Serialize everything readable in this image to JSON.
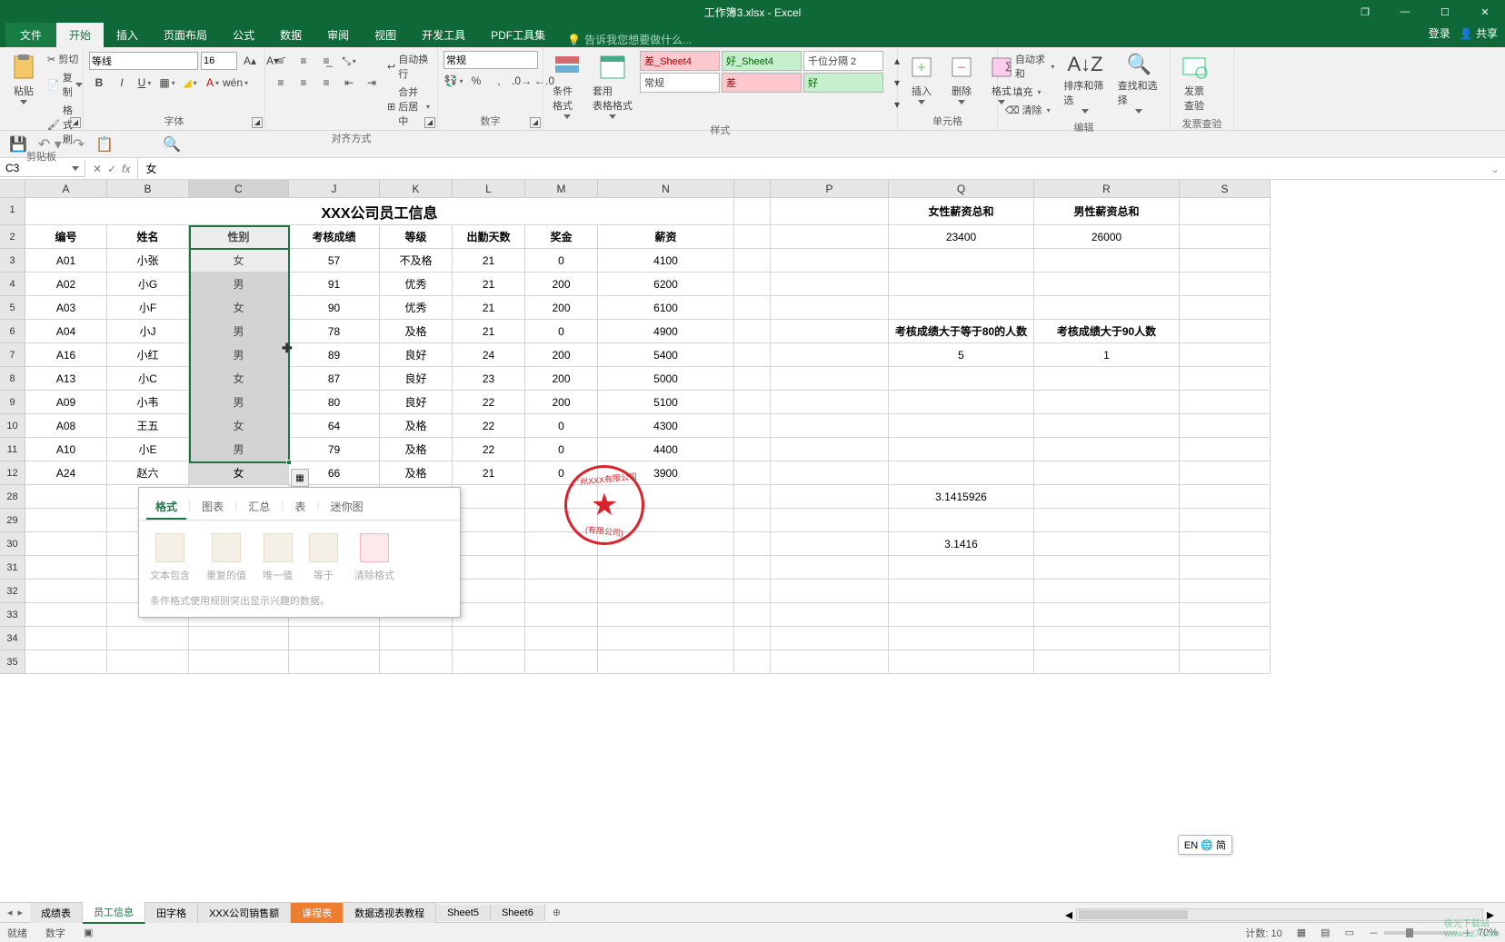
{
  "app": {
    "doc_title": "工作簿3.xlsx - Excel"
  },
  "window": {
    "restore": "❐",
    "min": "—",
    "max": "☐",
    "close": "✕"
  },
  "signin": {
    "login": "登录",
    "share": "共享"
  },
  "tabs": {
    "file": "文件",
    "home": "开始",
    "insert": "插入",
    "layout": "页面布局",
    "formula": "公式",
    "data": "数据",
    "review": "审阅",
    "view": "视图",
    "dev": "开发工具",
    "pdf": "PDF工具集",
    "tellme": "告诉我您想要做什么..."
  },
  "ribbon": {
    "clipboard": {
      "label": "剪贴板",
      "paste": "粘贴",
      "cut": "剪切",
      "copy": "复制",
      "painter": "格式刷"
    },
    "font": {
      "label": "字体",
      "name": "等线",
      "size": "16"
    },
    "align": {
      "label": "对齐方式",
      "wrap": "自动换行",
      "merge": "合并后居中"
    },
    "number": {
      "label": "数字",
      "format": "常规"
    },
    "styles": {
      "label": "样式",
      "cond": "条件格式",
      "table": "套用\n表格格式",
      "bad": "差_Sheet4",
      "good": "好_Sheet4",
      "thousand": "千位分隔 2",
      "normal": "常规",
      "bad2": "差",
      "good2": "好"
    },
    "cells": {
      "label": "单元格",
      "insert": "插入",
      "delete": "删除",
      "format": "格式"
    },
    "editing": {
      "label": "编辑",
      "sum": "自动求和",
      "fill": "填充",
      "clear": "清除",
      "sort": "排序和筛选",
      "find": "查找和选择"
    },
    "invoice": {
      "label": "发票查验",
      "check": "发票\n查验"
    }
  },
  "name_box": "C3",
  "fx_value": "女",
  "cols": [
    "A",
    "B",
    "C",
    "J",
    "K",
    "L",
    "M",
    "N",
    "",
    "P",
    "Q",
    "R",
    "S"
  ],
  "cw": [
    90,
    90,
    110,
    100,
    80,
    80,
    80,
    150,
    40,
    130,
    160,
    160,
    100
  ],
  "row_nums_top": [
    "1",
    "2",
    "3",
    "4",
    "5",
    "6",
    "7",
    "8",
    "9",
    "10",
    "11",
    "12"
  ],
  "row_nums_bottom": [
    "28",
    "29",
    "30",
    "31",
    "32",
    "33",
    "34",
    "35"
  ],
  "title_row": "XXX公司员工信息",
  "headers": [
    "编号",
    "姓名",
    "性别",
    "考核成绩",
    "等级",
    "出勤天数",
    "奖金",
    "薪资"
  ],
  "q_headers": {
    "q1": "女性薪资总和",
    "r1": "男性薪资总和",
    "q5": "考核成绩大于等于80的人数",
    "r5": "考核成绩大于90人数"
  },
  "q_vals": {
    "q2": "23400",
    "r2": "26000",
    "q6": "5",
    "r6": "1",
    "q28": "3.1415926",
    "q30": "3.1416"
  },
  "data": [
    {
      "id": "A01",
      "name": "小张",
      "sex": "女",
      "score": "57",
      "grade": "不及格",
      "days": "21",
      "bonus": "0",
      "salary": "4100"
    },
    {
      "id": "A02",
      "name": "小G",
      "sex": "男",
      "score": "91",
      "grade": "优秀",
      "days": "21",
      "bonus": "200",
      "salary": "6200"
    },
    {
      "id": "A03",
      "name": "小F",
      "sex": "女",
      "score": "90",
      "grade": "优秀",
      "days": "21",
      "bonus": "200",
      "salary": "6100"
    },
    {
      "id": "A04",
      "name": "小J",
      "sex": "男",
      "score": "78",
      "grade": "及格",
      "days": "21",
      "bonus": "0",
      "salary": "4900"
    },
    {
      "id": "A16",
      "name": "小红",
      "sex": "男",
      "score": "89",
      "grade": "良好",
      "days": "24",
      "bonus": "200",
      "salary": "5400"
    },
    {
      "id": "A13",
      "name": "小C",
      "sex": "女",
      "score": "87",
      "grade": "良好",
      "days": "23",
      "bonus": "200",
      "salary": "5000"
    },
    {
      "id": "A09",
      "name": "小韦",
      "sex": "男",
      "score": "80",
      "grade": "良好",
      "days": "22",
      "bonus": "200",
      "salary": "5100"
    },
    {
      "id": "A08",
      "name": "王五",
      "sex": "女",
      "score": "64",
      "grade": "及格",
      "days": "22",
      "bonus": "0",
      "salary": "4300"
    },
    {
      "id": "A10",
      "name": "小E",
      "sex": "男",
      "score": "79",
      "grade": "及格",
      "days": "22",
      "bonus": "0",
      "salary": "4400"
    },
    {
      "id": "A24",
      "name": "赵六",
      "sex": "女",
      "score": "66",
      "grade": "及格",
      "days": "21",
      "bonus": "0",
      "salary": "3900"
    }
  ],
  "quick": {
    "tabs": [
      "格式",
      "图表",
      "汇总",
      "表",
      "迷你图"
    ],
    "items": [
      "文本包含",
      "重复的值",
      "唯一值",
      "等于",
      "清除格式"
    ],
    "help": "条件格式使用规则突出显示兴趣的数据。"
  },
  "sheets": [
    "成绩表",
    "员工信息",
    "田字格",
    "XXX公司销售额",
    "课程表",
    "数据透视表教程",
    "Sheet5",
    "Sheet6"
  ],
  "ime": "EN 🌐 简",
  "status": {
    "ready": "就绪",
    "num": "数字",
    "count": "计数: 10",
    "zoom": "70%"
  }
}
